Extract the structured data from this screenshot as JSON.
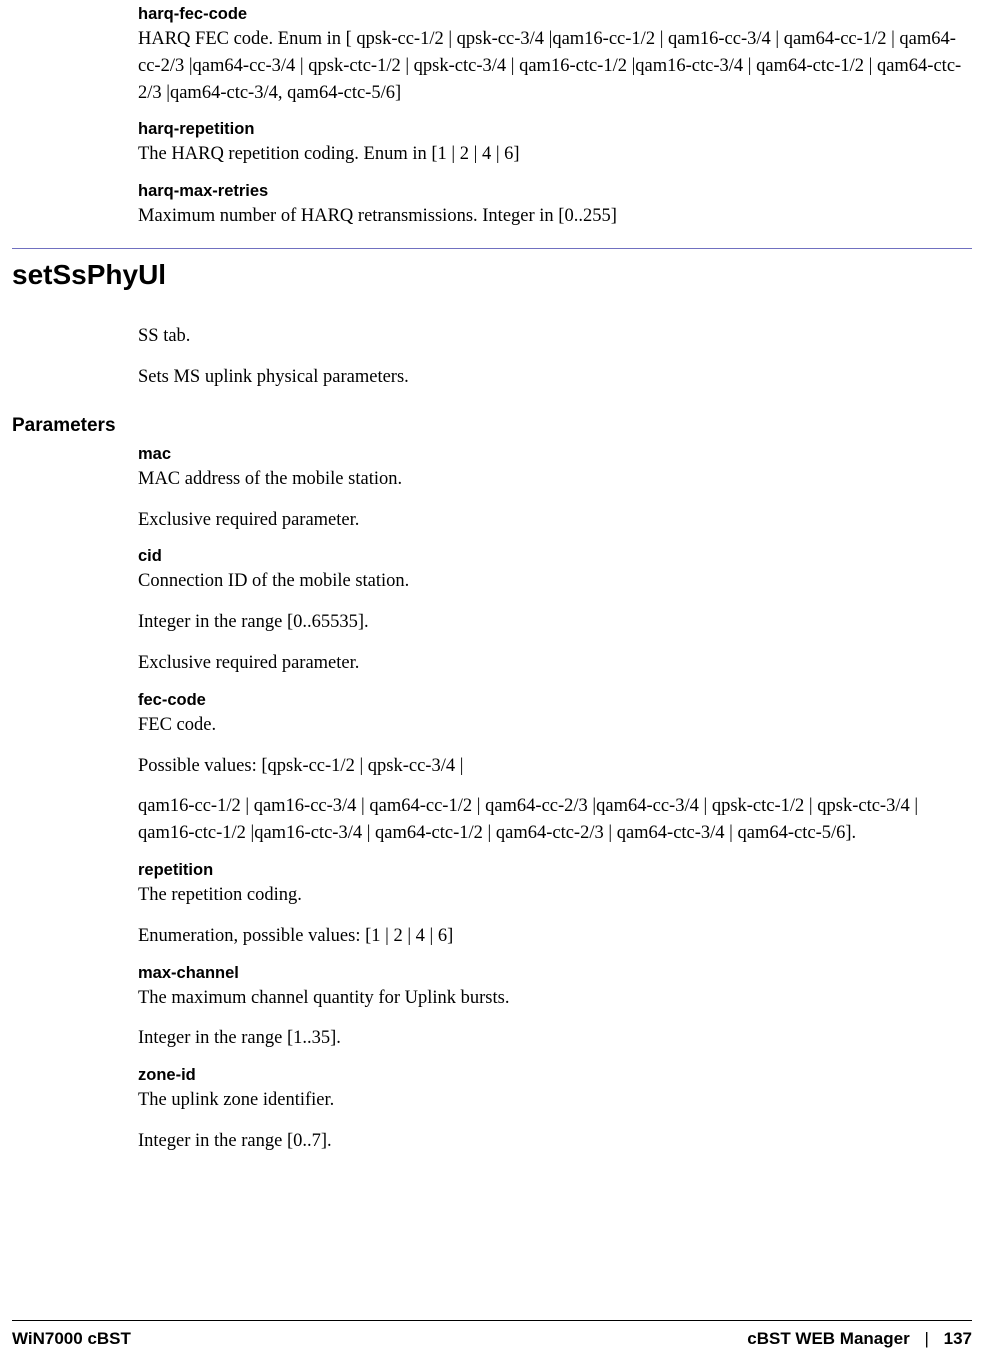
{
  "pre": {
    "items": [
      {
        "term": "harq-fec-code",
        "desc": "HARQ FEC code. Enum in [ qpsk-cc-1/2 | qpsk-cc-3/4 |qam16-cc-1/2 | qam16-cc-3/4 | qam64-cc-1/2 | qam64-cc-2/3 |qam64-cc-3/4 | qpsk-ctc-1/2 | qpsk-ctc-3/4 | qam16-ctc-1/2 |qam16-ctc-3/4 | qam64-ctc-1/2 | qam64-ctc-2/3 |qam64-ctc-3/4, qam64-ctc-5/6]"
      },
      {
        "term": "harq-repetition",
        "desc": "The HARQ repetition coding. Enum in [1 | 2 | 4 | 6]"
      },
      {
        "term": "harq-max-retries",
        "desc": "Maximum number of HARQ retransmissions. Integer in [0..255]"
      }
    ]
  },
  "section": {
    "title": "setSsPhyUl",
    "intro": [
      "SS tab.",
      "Sets MS uplink physical parameters."
    ],
    "paramsHeading": "Parameters",
    "params": [
      {
        "term": "mac",
        "paras": [
          "MAC address of the mobile station.",
          "Exclusive required parameter."
        ]
      },
      {
        "term": "cid",
        "paras": [
          "Connection ID of the mobile station.",
          "Integer in the range [0..65535].",
          "Exclusive required parameter."
        ]
      },
      {
        "term": "fec-code",
        "paras": [
          "FEC code.",
          "Possible values: [qpsk-cc-1/2 | qpsk-cc-3/4 |",
          "qam16-cc-1/2 | qam16-cc-3/4 | qam64-cc-1/2 | qam64-cc-2/3 |qam64-cc-3/4 | qpsk-ctc-1/2 | qpsk-ctc-3/4 | qam16-ctc-1/2 |qam16-ctc-3/4 | qam64-ctc-1/2 | qam64-ctc-2/3 | qam64-ctc-3/4 | qam64-ctc-5/6]."
        ]
      },
      {
        "term": "repetition",
        "paras": [
          "The repetition coding.",
          "Enumeration, possible values: [1 | 2 | 4 | 6]"
        ]
      },
      {
        "term": "max-channel",
        "paras": [
          "The maximum channel quantity for Uplink bursts.",
          "Integer in the range [1..35]."
        ]
      },
      {
        "term": "zone-id",
        "paras": [
          "The uplink zone identifier.",
          "Integer in the range [0..7]."
        ]
      }
    ]
  },
  "footer": {
    "left": "WiN7000 cBST",
    "right": "cBST WEB Manager",
    "sep": "|",
    "page": "137"
  }
}
